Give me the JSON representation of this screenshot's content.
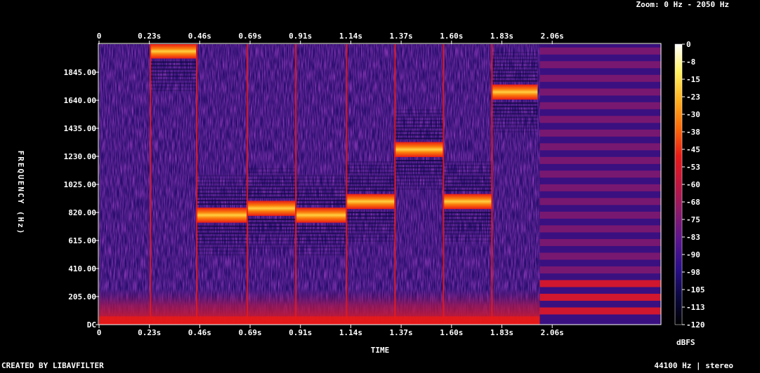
{
  "header": {
    "zoom": "Zoom: 0 Hz - 2050 Hz"
  },
  "footer": {
    "created_by": "CREATED BY LIBAVFILTER",
    "audio_info": "44100 Hz | stereo"
  },
  "chart_data": {
    "type": "heatmap",
    "title": "",
    "xlabel": "TIME",
    "ylabel": "FREQUENCY (Hz)",
    "xlim": [
      0,
      2.55
    ],
    "ylim": [
      0,
      2050
    ],
    "x_ticks": [
      "0",
      "0.23s",
      "0.46s",
      "0.69s",
      "0.91s",
      "1.14s",
      "1.37s",
      "1.60s",
      "1.83s",
      "2.06s"
    ],
    "y_ticks": [
      "DC",
      "205.00",
      "410.00",
      "615.00",
      "820.00",
      "1025.00",
      "1230.00",
      "1435.00",
      "1640.00",
      "1845.00"
    ],
    "colorbar": {
      "label": "dBFS",
      "range": [
        -120,
        0
      ],
      "ticks": [
        "0",
        "-8",
        "-15",
        "-23",
        "-30",
        "-38",
        "-45",
        "-53",
        "-60",
        "-68",
        "-75",
        "-83",
        "-90",
        "-98",
        "-105",
        "-113",
        "-120"
      ]
    },
    "tones": [
      {
        "t_start": 0.23,
        "t_end": 0.44,
        "freq_hz": 2000
      },
      {
        "t_start": 0.44,
        "t_end": 0.67,
        "freq_hz": 800
      },
      {
        "t_start": 0.67,
        "t_end": 0.89,
        "freq_hz": 850
      },
      {
        "t_start": 0.89,
        "t_end": 1.12,
        "freq_hz": 800
      },
      {
        "t_start": 1.12,
        "t_end": 1.34,
        "freq_hz": 900
      },
      {
        "t_start": 1.34,
        "t_end": 1.56,
        "freq_hz": 1280
      },
      {
        "t_start": 1.56,
        "t_end": 1.78,
        "freq_hz": 900
      },
      {
        "t_start": 1.78,
        "t_end": 1.99,
        "freq_hz": 1700
      }
    ],
    "harmonic_segment": {
      "t_start": 2.0,
      "t_end": 2.55,
      "spacing_hz": 100
    },
    "colormap": [
      "#000000",
      "#0b0840",
      "#2a0e8a",
      "#5a148f",
      "#8a1a6c",
      "#c01640",
      "#e81a18",
      "#fb6a0a",
      "#ffb020",
      "#fff060",
      "#ffffff"
    ]
  }
}
